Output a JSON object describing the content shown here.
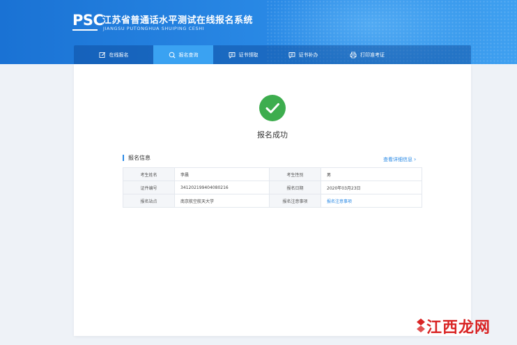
{
  "header": {
    "logo_text": "PSC",
    "title": "江苏省普通话水平测试在线报名系统",
    "subtitle": "JIANGSU PUTONGHUA SHUIPING CESHI"
  },
  "nav": {
    "items": [
      {
        "label": "在线报名",
        "icon": "edit-icon"
      },
      {
        "label": "报名查询",
        "icon": "search-icon"
      },
      {
        "label": "证书领取",
        "icon": "chat-icon"
      },
      {
        "label": "证书补办",
        "icon": "chat-icon"
      },
      {
        "label": "打印准考证",
        "icon": "printer-icon"
      }
    ],
    "active_index": 1
  },
  "result": {
    "status_text": "报名成功"
  },
  "info": {
    "section_title": "报名信息",
    "detail_link": "查看详细信息",
    "rows": [
      {
        "label1": "考生姓名",
        "value1": "李晨",
        "label2": "考生性别",
        "value2": "男"
      },
      {
        "label1": "证件编号",
        "value1": "341202199404080216",
        "label2": "报名日期",
        "value2": "2020年03月23日"
      },
      {
        "label1": "报名站点",
        "value1": "南京航空航天大学",
        "label2": "报名注意事项",
        "value2": "报名注意事项"
      }
    ]
  },
  "watermark": {
    "text": "江西龙网"
  },
  "colors": {
    "header_blue": "#1a72d4",
    "nav_active": "#3aa2f2",
    "success_green": "#3dad4e",
    "link_blue": "#2a8ae6",
    "watermark_red": "#d92424"
  }
}
